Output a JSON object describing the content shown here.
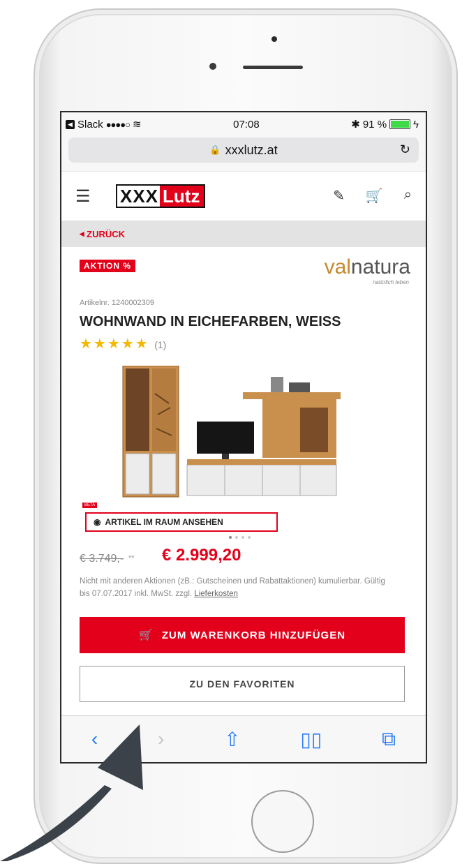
{
  "status": {
    "app": "Slack",
    "signal": "●●●●○",
    "time": "07:08",
    "battery_pct": "91 %",
    "battery_level": 0.91
  },
  "browser": {
    "url": "xxxlutz.at"
  },
  "header": {
    "logo_a": "XXX",
    "logo_b": "Lutz"
  },
  "nav": {
    "back_label": "ZURÜCK"
  },
  "product": {
    "badge": "AKTION %",
    "brand_a": "val",
    "brand_b": "natura",
    "brand_tagline": "natürlich leben",
    "artnr": "Artikelnr. 1240002309",
    "title": "WOHNWAND IN EICHEFARBEN, WEISS",
    "stars": "★★★★★",
    "review_count": "(1)",
    "beta": "BETA",
    "view_in_room": "ARTIKEL IM RAUM ANSEHEN",
    "old_price": "€ 3.749,-",
    "old_price_marker": "**",
    "price": "€ 2.999,20",
    "note_text": "Nicht mit anderen Aktionen (zB.: Gutscheinen und Rabattaktionen) kumulierbar. Gültig bis 07.07.2017 inkl. MwSt. zzgl.",
    "note_link": "Lieferkosten",
    "cart_label": "ZUM WARENKORB HINZUFÜGEN",
    "fav_label": "ZU DEN FAVORITEN"
  },
  "colors": {
    "brand_red": "#e2001a",
    "ios_blue": "#2a7cf6",
    "star": "#f5b800"
  }
}
